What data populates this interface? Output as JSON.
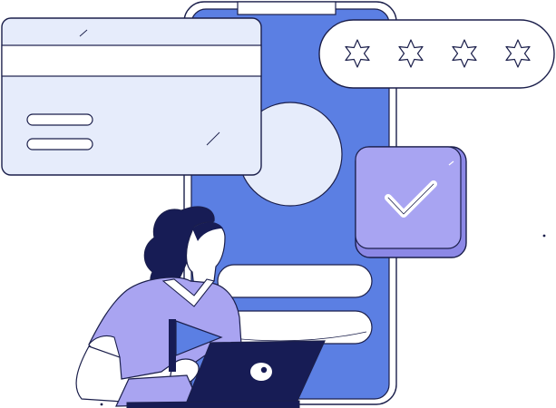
{
  "illustration": {
    "colors": {
      "outline": "#1b1f4b",
      "phone_screen": "#5b7fe3",
      "phone_frame": "#ffffff",
      "card_fill": "#e6ecfb",
      "check_tile": "#a8a4f2",
      "check_tile_shadow": "#8c88e6",
      "shirt": "#a9a4f1",
      "hair": "#171c55",
      "laptop": "#171c55",
      "skin": "#ffffff",
      "flag": "#5b7fe3"
    },
    "rating": {
      "stars_total": 4,
      "stars_filled": 0,
      "icon": "star-outline-icon"
    },
    "payment_card": {
      "lines": 2
    },
    "check_badge": {
      "icon": "checkmark-icon",
      "state": "checked"
    },
    "phone": {
      "profile_placeholder": "avatar-circle",
      "content_bars": 2
    },
    "person": {
      "pose": "seated-with-laptop",
      "holding": "flag"
    }
  }
}
